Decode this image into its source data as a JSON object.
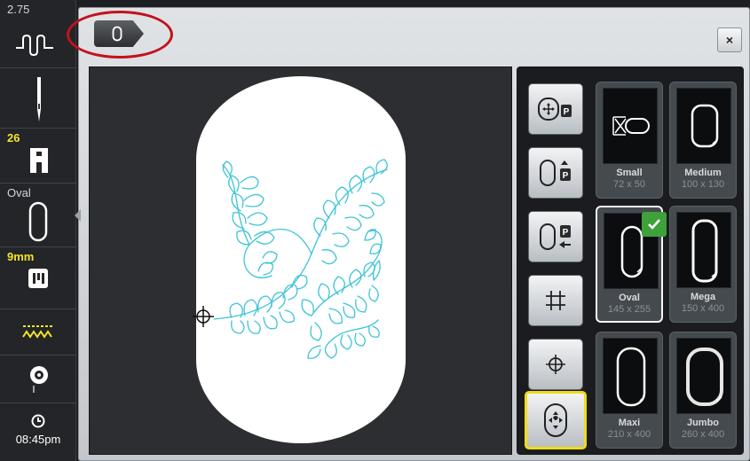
{
  "sidebar": {
    "stitch_width": "2.75",
    "presser_foot": "26",
    "hoop_label": "Oval",
    "stitch_length": "9mm",
    "time": "08:45pm"
  },
  "hoops": [
    {
      "name": "Small",
      "dims": "72 x 50",
      "selected": false
    },
    {
      "name": "Medium",
      "dims": "100 x 130",
      "selected": false
    },
    {
      "name": "Oval",
      "dims": "145 x 255",
      "selected": true
    },
    {
      "name": "Mega",
      "dims": "150 x 400",
      "selected": false
    },
    {
      "name": "Maxi",
      "dims": "210 x 400",
      "selected": false
    },
    {
      "name": "Jumbo",
      "dims": "260 x 400",
      "selected": false
    }
  ],
  "dialog": {
    "close_label": "×"
  },
  "colors": {
    "embroidery_thread": "#3cc4d6",
    "selected_tool_border": "#f1dc17",
    "highlight_circle": "#c2121e",
    "check_badge": "#3ea13a"
  },
  "icons": [
    "stitch-width-icon",
    "needle-icon",
    "presser-foot-icon",
    "oval-hoop-icon",
    "stitch-length-icon",
    "stitch-pattern-icon",
    "bobbin-icon",
    "clock-icon",
    "close-icon",
    "hoop-park-icon",
    "hoop-move-up-icon",
    "hoop-move-left-icon",
    "grid-icon",
    "center-icon",
    "embroidery-center-icon",
    "checkmark-icon"
  ]
}
